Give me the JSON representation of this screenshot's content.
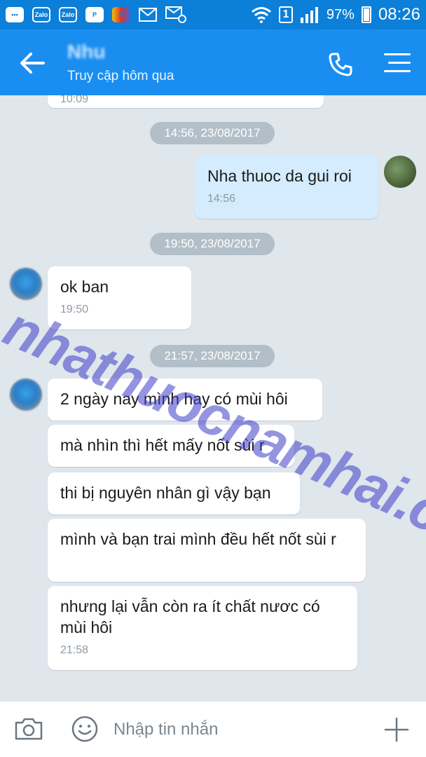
{
  "status_bar": {
    "app_icons": [
      "Zalo",
      "Zalo"
    ],
    "battery": "97%",
    "time": "08:26",
    "sim": "1"
  },
  "header": {
    "contact_name": "Nhu",
    "last_seen": "Truy cập hôm qua"
  },
  "messages": {
    "top_partial_time": "10:09",
    "ts1": "14:56, 23/08/2017",
    "out1_text": "Nha thuoc da gui roi",
    "out1_time": "14:56",
    "ts2": "19:50, 23/08/2017",
    "in1_text": "ok ban",
    "in1_time": "19:50",
    "ts3": "21:57, 23/08/2017",
    "in2_text": "2 ngày nay mình hay có mùi hôi",
    "in3_text": "mà nhìn thì hết mấy nốt sùi r",
    "in4_text": "thi bị nguyên nhân gì vậy bạn",
    "in5_text": "mình và bạn trai mình đều hết nốt sùi r",
    "in6_text": "nhưng lại vẫn còn ra ít chất nươc có mùi hôi",
    "in6_time": "21:58"
  },
  "watermark": "nhathuocnamhai.com.vn",
  "input_bar": {
    "placeholder": "Nhập tin nhắn"
  },
  "colors": {
    "header": "#1a8ef0",
    "status": "#0c7fd8",
    "outgoing_bubble": "#d4ecfd",
    "chat_bg": "#dfe6ec"
  }
}
